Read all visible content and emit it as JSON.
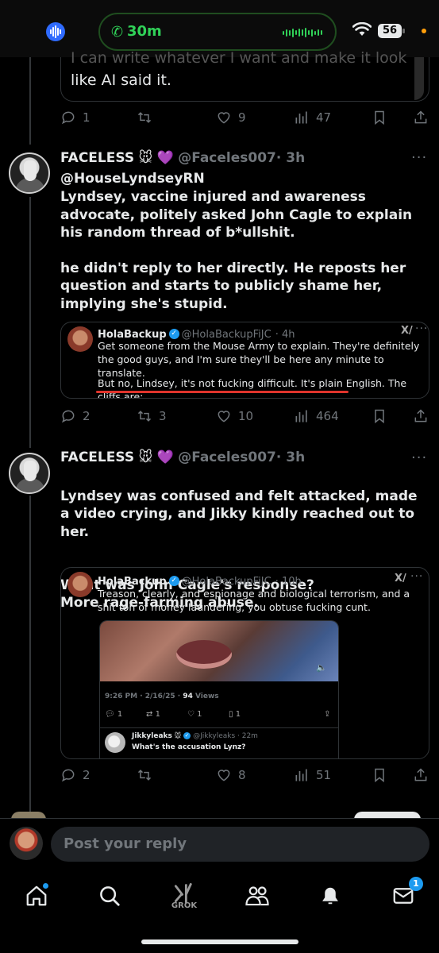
{
  "status_bar": {
    "call_time": "30m",
    "battery": "56"
  },
  "previous_tweet": {
    "quote_text_fragment": "like AI said it.",
    "stats": {
      "replies": "1",
      "reposts": "",
      "likes": "9",
      "views": "47"
    }
  },
  "tweets": [
    {
      "author": "FACELESS",
      "emojis": "🐭 💜",
      "handle": "@Faceles007",
      "time": "· 3h",
      "mention": "@HouseLyndseyRN",
      "paragraphs": [
        "Lyndsey, vaccine injured and awareness advocate, politely asked John Cagle to explain his random thread of b*ullshit.",
        "he didn't reply to her directly. He reposts her question and starts to publicly shame her, implying she's stupid."
      ],
      "quote": {
        "name": "HolaBackup",
        "handle": "@HolaBackupFiJC",
        "time": "· 4h",
        "text": "Get someone from the Mouse Army to explain. They're definitely the good guys, and I'm sure they'll be here any minute to translate.",
        "text2": "But no, Lindsey, it's not fucking difficult. It's plain English. The cliffs are:"
      },
      "stats": {
        "replies": "2",
        "reposts": "3",
        "likes": "10",
        "views": "464"
      }
    },
    {
      "author": "FACELESS",
      "emojis": "🐭 💜",
      "handle": "@Faceles007",
      "time": "· 3h",
      "paragraphs": [
        "Lyndsey was confused and felt attacked, made a video crying, and Jikky kindly reached out to her.",
        "What was John Cagle's response?\nMore rage-farming abuse."
      ],
      "quote": {
        "name": "HolaBackup",
        "handle": "@HolaBackupFiJC",
        "time": "· 10h",
        "text": "Treason, clearly, and espionage and biological terrorism, and a shit ton of money laundering, you obtuse fucking cunt.",
        "inner": {
          "timestamp": "9:26 PM · 2/16/25 · ",
          "views": "94",
          "views_label": "Views",
          "replies": "1",
          "reposts": "1",
          "likes": "1",
          "bookmarks": "1",
          "reply_name": "Jikkyleaks",
          "reply_handle": "@Jikkyleaks · 22m",
          "reply_text": "What's the accusation Lynz?"
        }
      },
      "stats": {
        "replies": "2",
        "reposts": "",
        "likes": "8",
        "views": "51"
      }
    }
  ],
  "compose": {
    "placeholder": "Post your reply"
  },
  "nav": {
    "grok_label": "GROK",
    "messages_badge": "1"
  },
  "colors": {
    "accent": "#1d9bf0",
    "underline": "#e0342c",
    "call_green": "#30d158"
  }
}
